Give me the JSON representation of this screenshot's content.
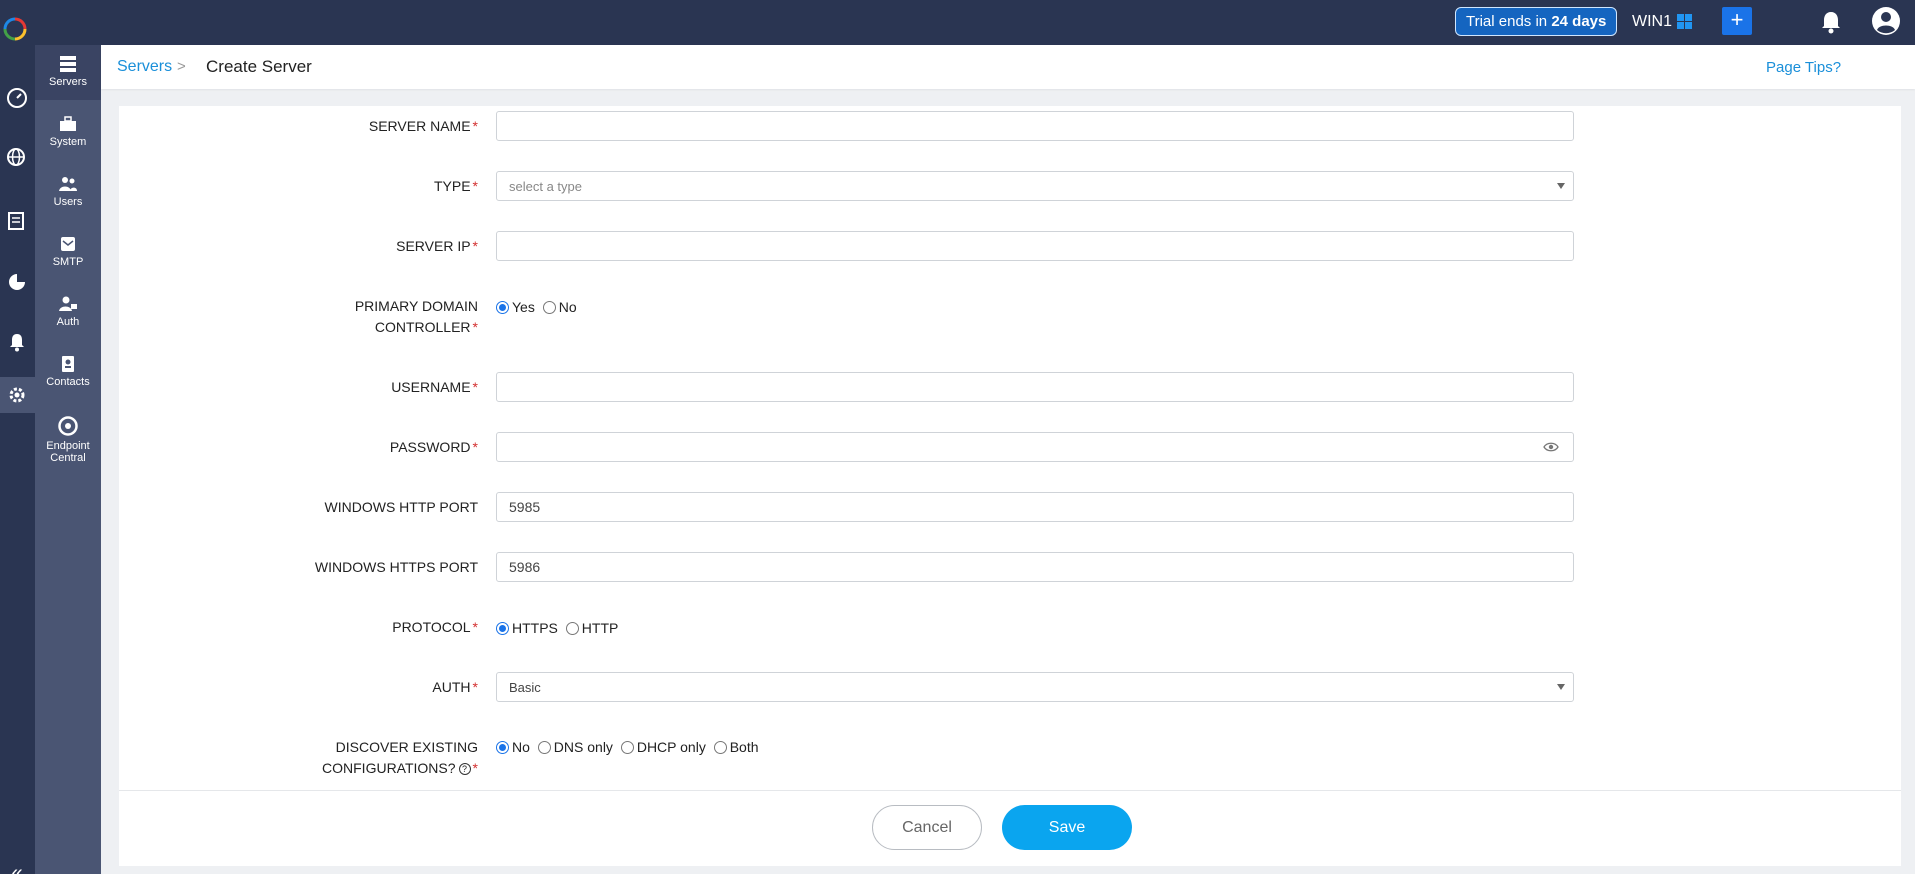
{
  "topbar": {
    "trial_prefix": "Trial ends in ",
    "trial_days": "24 days",
    "server_label": "WIN1",
    "add_symbol": "+"
  },
  "subnav": {
    "items": [
      {
        "label": "Servers",
        "icon": "servers-icon"
      },
      {
        "label": "System",
        "icon": "toolbox-icon"
      },
      {
        "label": "Users",
        "icon": "users-icon"
      },
      {
        "label": "SMTP",
        "icon": "mail-icon"
      },
      {
        "label": "Auth",
        "icon": "user-lock-icon"
      },
      {
        "label": "Contacts",
        "icon": "contact-card-icon"
      },
      {
        "label": "Endpoint",
        "label2": "Central",
        "icon": "endpoint-central-icon"
      }
    ]
  },
  "breadcrumb": {
    "parent": "Servers",
    "separator": ">",
    "current": "Create Server",
    "page_tips": "Page Tips?"
  },
  "form": {
    "server_name": {
      "label": "SERVER NAME",
      "value": ""
    },
    "type": {
      "label": "TYPE",
      "placeholder": "select a type"
    },
    "server_ip": {
      "label": "SERVER IP",
      "value": ""
    },
    "primary_dc": {
      "label_line1": "PRIMARY DOMAIN",
      "label_line2": "CONTROLLER",
      "options": [
        "Yes",
        "No"
      ],
      "selected": "Yes"
    },
    "username": {
      "label": "USERNAME",
      "value": ""
    },
    "password": {
      "label": "PASSWORD",
      "value": ""
    },
    "http_port": {
      "label": "WINDOWS HTTP PORT",
      "value": "5985"
    },
    "https_port": {
      "label": "WINDOWS HTTPS PORT",
      "value": "5986"
    },
    "protocol": {
      "label": "PROTOCOL",
      "options": [
        "HTTPS",
        "HTTP"
      ],
      "selected": "HTTPS"
    },
    "auth": {
      "label": "AUTH",
      "value": "Basic"
    },
    "discover": {
      "label_line1": "DISCOVER EXISTING",
      "label_line2": "CONFIGURATIONS?",
      "options": [
        "No",
        "DNS only",
        "DHCP only",
        "Both"
      ],
      "selected": "No"
    },
    "required_mark": "*",
    "help_mark": "?"
  },
  "actions": {
    "cancel": "Cancel",
    "save": "Save"
  },
  "colors": {
    "topbar": "#2a3552",
    "subnav": "#4a5573",
    "accent": "#0aa5ef",
    "link": "#1a8fd9",
    "required": "#d32f2f"
  }
}
